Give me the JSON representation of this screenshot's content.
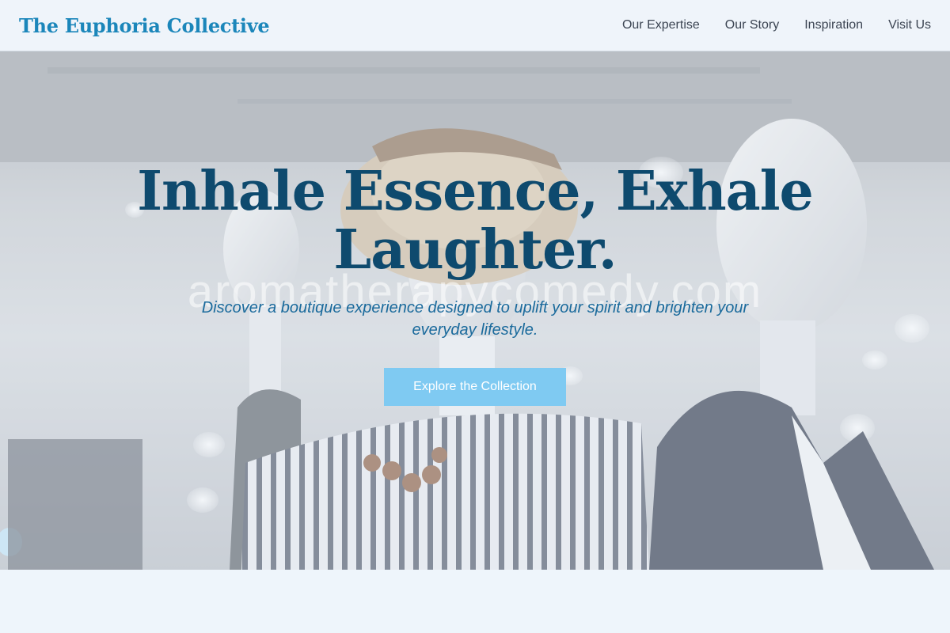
{
  "header": {
    "brand": "The Euphoria Collective",
    "nav": [
      {
        "label": "Our Expertise"
      },
      {
        "label": "Our Story"
      },
      {
        "label": "Inspiration"
      },
      {
        "label": "Visit Us"
      }
    ]
  },
  "hero": {
    "title": "Inhale Essence, Exhale Laughter.",
    "subtitle": "Discover a boutique experience designed to uplift your spirit and brighten your everyday lifestyle.",
    "cta_label": "Explore the Collection",
    "watermark": "aromatherapycomedy.com"
  },
  "colors": {
    "brand": "#1b86ba",
    "title": "#0e4a6e",
    "subtitle": "#1a6a9c",
    "cta_bg": "#7fcaf2"
  }
}
